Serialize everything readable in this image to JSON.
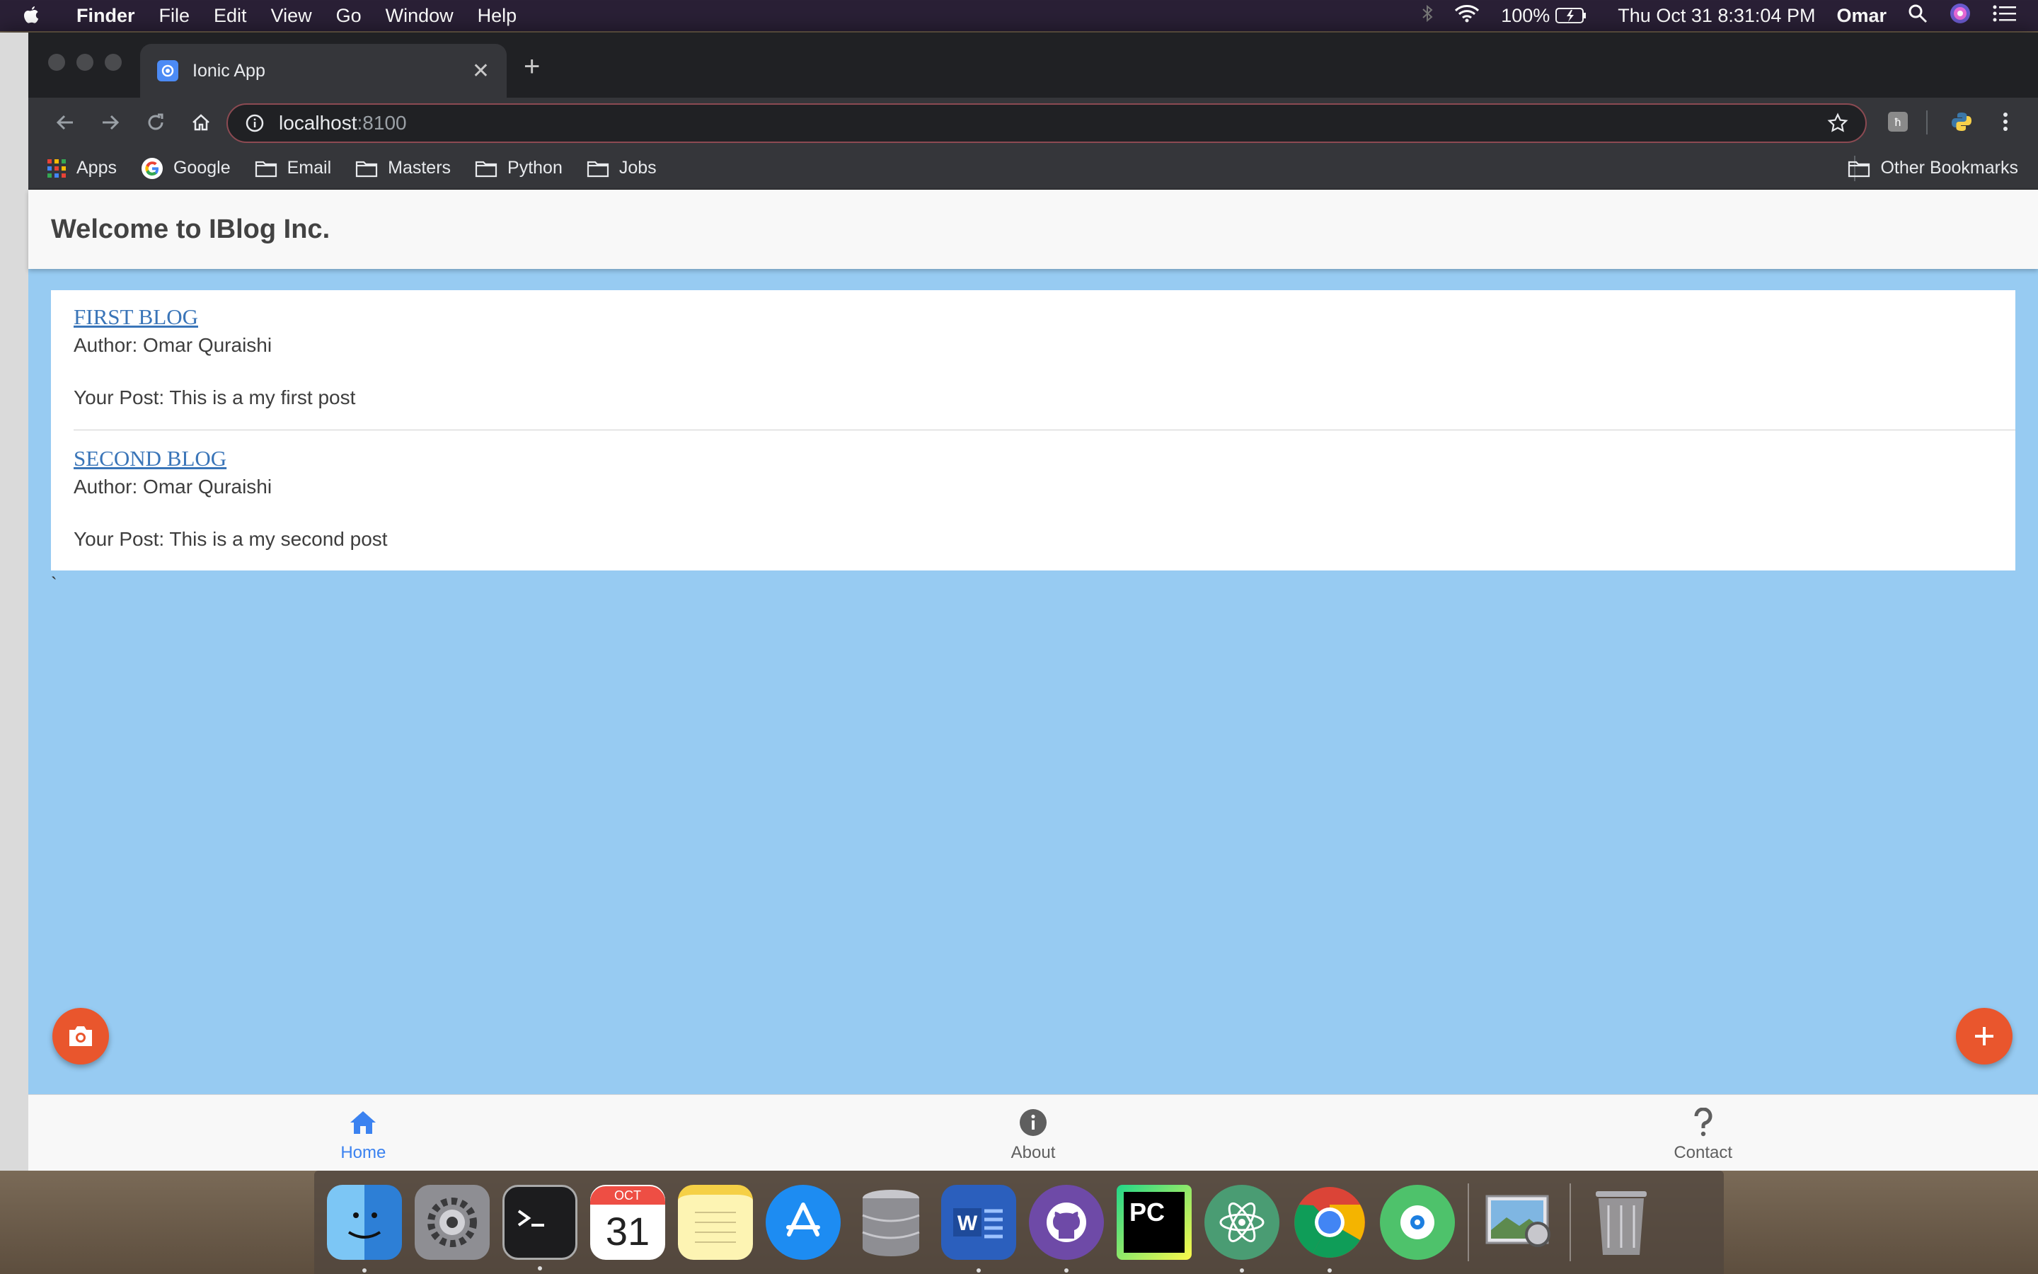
{
  "menubar": {
    "app_name": "Finder",
    "menus": [
      "File",
      "Edit",
      "View",
      "Go",
      "Window",
      "Help"
    ],
    "battery": "100%",
    "datetime": "Thu Oct 31  8:31:04 PM",
    "user": "Omar"
  },
  "browser": {
    "tab_title": "Ionic App",
    "address_host": "localhost",
    "address_port": ":8100",
    "bookmarks": [
      "Apps",
      "Google",
      "Email",
      "Masters",
      "Python",
      "Jobs"
    ],
    "other_bookmarks": "Other Bookmarks"
  },
  "app": {
    "header_title": "Welcome to IBlog Inc.",
    "posts": [
      {
        "title": "FIRST BLOG",
        "author": "Author: Omar Quraishi",
        "body": "Your Post: This is a my first post"
      },
      {
        "title": "SECOND BLOG",
        "author": "Author: Omar Quraishi",
        "body": "Your Post: This is a my second post"
      }
    ],
    "stray_char": "`",
    "tabs": [
      {
        "label": "Home",
        "icon": "home-icon",
        "active": true
      },
      {
        "label": "About",
        "icon": "info-icon",
        "active": false
      },
      {
        "label": "Contact",
        "icon": "question-icon",
        "active": false
      }
    ],
    "colors": {
      "background": "#97cbf2",
      "fab": "#e9562d",
      "active_tab": "#3b82f0",
      "link": "#3a75b8"
    }
  },
  "dock": {
    "apps": [
      "finder-icon",
      "system-preferences-icon",
      "terminal-icon",
      "calendar-icon",
      "notes-icon",
      "app-store-icon",
      "database-icon",
      "word-icon",
      "github-icon",
      "pycharm-icon",
      "atom-icon",
      "chrome-icon",
      "find-my-icon",
      "preview-icon",
      "trash-icon"
    ],
    "calendar_month": "OCT",
    "calendar_day": "31"
  }
}
